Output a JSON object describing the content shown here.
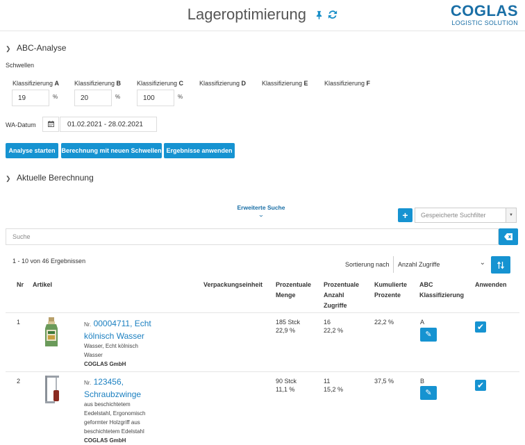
{
  "header": {
    "title": "Lageroptimierung",
    "pin_icon": "pin-icon",
    "refresh_icon": "refresh-icon",
    "logo_main": "COGLAS",
    "logo_sub": "LOGISTIC SOLUTION"
  },
  "abc": {
    "section_title": "ABC-Analyse",
    "thresholds_label": "Schwellen",
    "class_prefix": "Klassifizierung",
    "classes": [
      {
        "letter": "A",
        "value": "19",
        "unit": "%"
      },
      {
        "letter": "B",
        "value": "20",
        "unit": "%"
      },
      {
        "letter": "C",
        "value": "100",
        "unit": "%"
      },
      {
        "letter": "D"
      },
      {
        "letter": "E"
      },
      {
        "letter": "F"
      }
    ],
    "wa_label": "WA-Datum",
    "wa_value": "01.02.2021 - 28.02.2021",
    "buttons": {
      "start": "Analyse starten",
      "recalc": "Berechnung mit neuen Schwellen",
      "apply": "Ergebnisse anwenden"
    }
  },
  "current": {
    "section_title": "Aktuelle Berechnung",
    "advanced_search": "Erweiterte Suche",
    "saved_filter_placeholder": "Gespeicherte Suchfilter",
    "search_placeholder": "Suche",
    "result_count": "1 - 10 von 46 Ergebnissen",
    "sort_label": "Sortierung nach",
    "sort_value": "Anzahl Zugriffe",
    "columns": {
      "nr": "Nr",
      "article": "Artikel",
      "pack": "Verpackungseinheit",
      "pct_qty": [
        "Prozentuale",
        "Menge"
      ],
      "pct_hits": [
        "Prozentuale",
        "Anzahl",
        "Zugriffe"
      ],
      "cum": [
        "Kumulierte",
        "Prozente"
      ],
      "abc": [
        "ABC",
        "Klassifizierung"
      ],
      "apply": "Anwenden"
    },
    "rows": [
      {
        "nr": "1",
        "nr_prefix": "Nr.",
        "link_l1": "00004711,  Echt",
        "link_l2": "kölnisch Wasser",
        "desc": [
          "Wasser, Echt kölnisch",
          "Wasser"
        ],
        "company": "COGLAS GmbH",
        "qty": "185 Stck",
        "qty_pct": "22,9 %",
        "hits": "16",
        "hits_pct": "22,2 %",
        "cum": "22,2 %",
        "abc": "A",
        "applied": true
      },
      {
        "nr": "2",
        "nr_prefix": "Nr.",
        "link_l1": "123456,",
        "link_l2": "Schraubzwinge",
        "desc": [
          "aus beschichtetem",
          "Eedelstahl, Ergonomisch",
          "geformter Holzgriff aus",
          "beschichtetem Edelstahl"
        ],
        "company": "COGLAS GmbH",
        "qty": "90 Stck",
        "qty_pct": "11,1 %",
        "hits": "11",
        "hits_pct": "15,2 %",
        "cum": "37,5 %",
        "abc": "B",
        "applied": true
      }
    ]
  },
  "colors": {
    "accent": "#1693d1",
    "logo": "#1a6fa6"
  }
}
